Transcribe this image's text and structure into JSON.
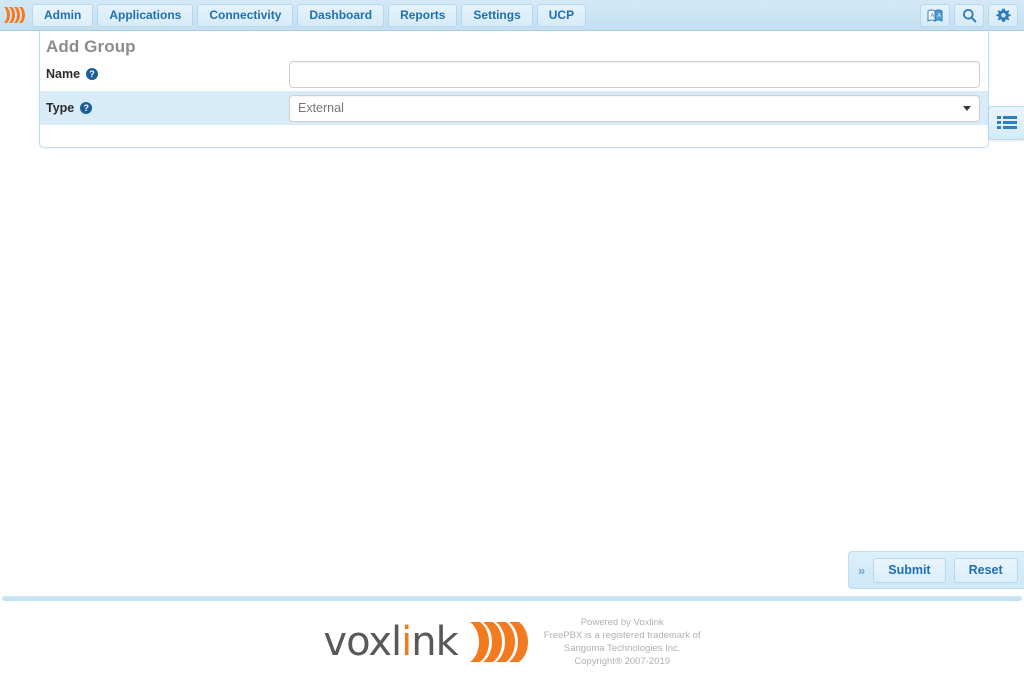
{
  "nav": {
    "brand_icon": "voxlink-swoosh-icon",
    "items": [
      {
        "label": "Admin",
        "name": "nav-admin"
      },
      {
        "label": "Applications",
        "name": "nav-applications"
      },
      {
        "label": "Connectivity",
        "name": "nav-connectivity"
      },
      {
        "label": "Dashboard",
        "name": "nav-dashboard"
      },
      {
        "label": "Reports",
        "name": "nav-reports"
      },
      {
        "label": "Settings",
        "name": "nav-settings"
      },
      {
        "label": "UCP",
        "name": "nav-ucp"
      }
    ],
    "right_icons": [
      {
        "name": "language-translate-icon"
      },
      {
        "name": "search-icon"
      },
      {
        "name": "gear-icon"
      }
    ]
  },
  "panel": {
    "title": "Add Group",
    "fields": [
      {
        "label": "Name",
        "help_glyph": "?",
        "control": "text",
        "value": "",
        "placeholder": ""
      },
      {
        "label": "Type",
        "help_glyph": "?",
        "control": "select",
        "value": "External",
        "options": [
          "External"
        ]
      }
    ],
    "side_button_icon": "list-view-icon"
  },
  "actions": {
    "expand_glyph": "»",
    "submit_label": "Submit",
    "reset_label": "Reset"
  },
  "footer": {
    "logo_text_start": "vox",
    "logo_text_i": "l",
    "logo_text_mid": "i",
    "logo_text_end": "nk",
    "logo_icon": "voxlink-swoosh-icon",
    "legal_lines": [
      "Powered by Voxlink",
      "FreePBX is a registered trademark of",
      "Sangoma Technologies Inc.",
      "Copyright® 2007-2019"
    ]
  },
  "colors": {
    "nav_bg": "#cbe4f4",
    "accent_blue": "#1f6fb2",
    "brand_orange": "#f47a20",
    "row_highlight": "#d8ebf9",
    "panel_border": "#bcdff3"
  }
}
